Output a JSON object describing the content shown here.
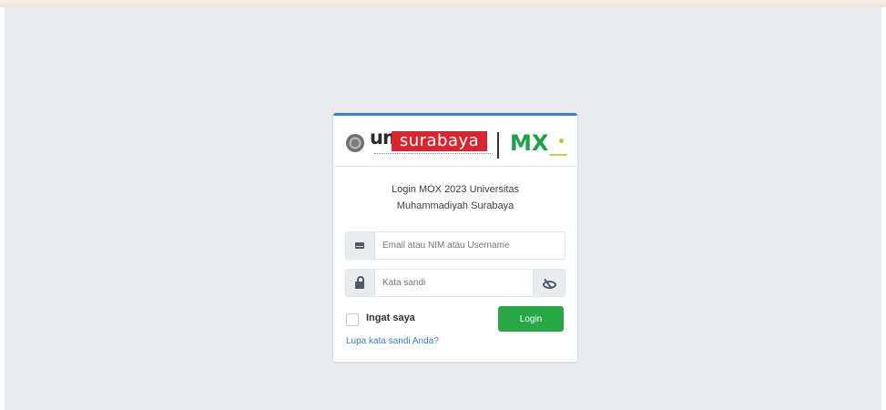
{
  "logo": {
    "um": "um",
    "surabaya": "surabaya",
    "mx": "MX"
  },
  "login": {
    "title_line1": "Login MOX 2023 Universitas",
    "title_line2": "Muhammadiyah Surabaya",
    "email_placeholder": "Email atau NIM atau Username",
    "password_placeholder": "Kata sandi",
    "remember_label": "Ingat saya",
    "button_label": "Login",
    "forgot_link": "Lupa kata sandi Anda?"
  },
  "colors": {
    "accent": "#2f84d6",
    "button": "#28a745",
    "brand_red": "#d7262f",
    "brand_green": "#1aa34a",
    "background": "#e9ecef"
  },
  "icons": {
    "email": "envelope-icon",
    "password": "lock-icon",
    "toggle_password": "eye-slash-icon"
  }
}
